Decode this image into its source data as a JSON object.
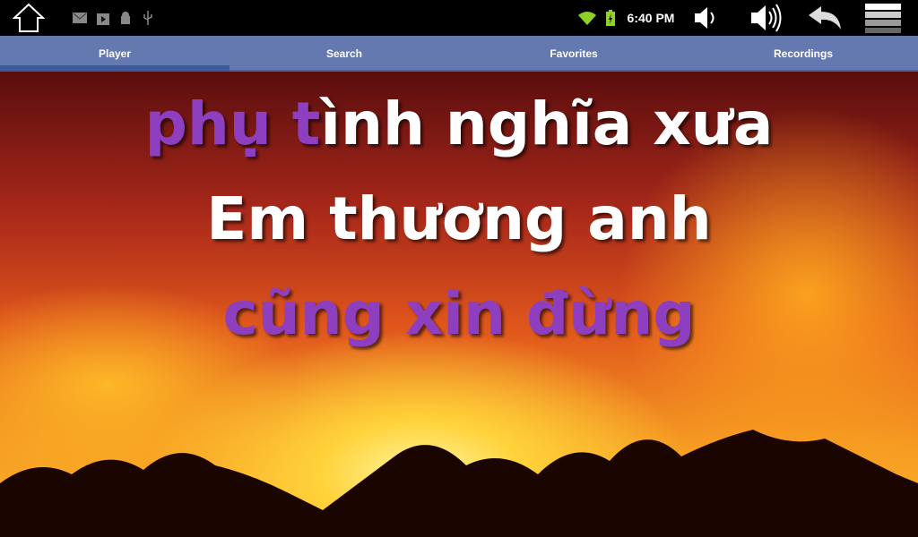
{
  "status_bar": {
    "time": "6:40 PM",
    "icons": [
      "home-icon",
      "gmail-icon",
      "play-store-icon",
      "android-debug-icon",
      "usb-icon",
      "wifi-icon",
      "battery-icon",
      "volume-down-icon",
      "volume-up-icon",
      "back-icon",
      "menu-icon"
    ]
  },
  "tabs": [
    {
      "label": "Player",
      "active": true
    },
    {
      "label": "Search"
    },
    {
      "label": "Favorites"
    },
    {
      "label": "Recordings"
    }
  ],
  "lyrics": {
    "line1_sung": "phụ t",
    "line1_rest": "ình nghĩa xưa",
    "line2": "Em thương anh",
    "line3": "cũng xin đừng"
  },
  "colors": {
    "sung": "#8e3fc0",
    "unsung": "#ffffff",
    "tab_bar": "#6479b0"
  }
}
